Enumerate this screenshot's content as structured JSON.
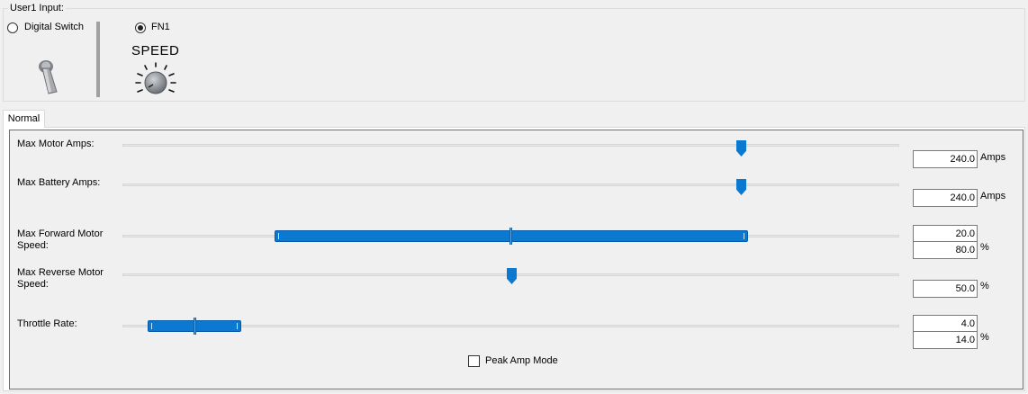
{
  "user_input": {
    "group_label": "User1 Input:",
    "options": [
      {
        "label": "Digital Switch",
        "selected": false,
        "icon": "toggle-switch-icon"
      },
      {
        "label": "FN1",
        "selected": true,
        "icon": "knob-icon"
      }
    ],
    "speed_title": "SPEED"
  },
  "tabs": [
    {
      "label": "Normal",
      "active": true
    }
  ],
  "sliders": [
    {
      "label_lines": [
        "Max Motor Amps:"
      ],
      "type": "single",
      "value_fraction": 0.797,
      "boxes": [
        "240.0"
      ],
      "unit": "Amps"
    },
    {
      "label_lines": [
        "Max Battery Amps:"
      ],
      "type": "single",
      "value_fraction": 0.797,
      "boxes": [
        "240.0"
      ],
      "unit": "Amps"
    },
    {
      "label_lines": [
        "Max Forward Motor",
        "Speed:"
      ],
      "type": "range",
      "low": 20.0,
      "high": 80.0,
      "boxes": [
        "20.0",
        "80.0"
      ],
      "unit": "%"
    },
    {
      "label_lines": [
        "Max Reverse Motor",
        "Speed:"
      ],
      "type": "single",
      "value_fraction": 0.5,
      "boxes": [
        "50.0"
      ],
      "unit": "%"
    },
    {
      "label_lines": [
        "Throttle Rate:"
      ],
      "type": "range",
      "low": 4.0,
      "high": 14.0,
      "boxes": [
        "4.0",
        "14.0"
      ],
      "unit": "%"
    }
  ],
  "peak_amp_mode": {
    "label": "Peak Amp Mode",
    "checked": false
  },
  "colors": {
    "accent": "#0b79d0",
    "background": "#f0f0f0"
  }
}
